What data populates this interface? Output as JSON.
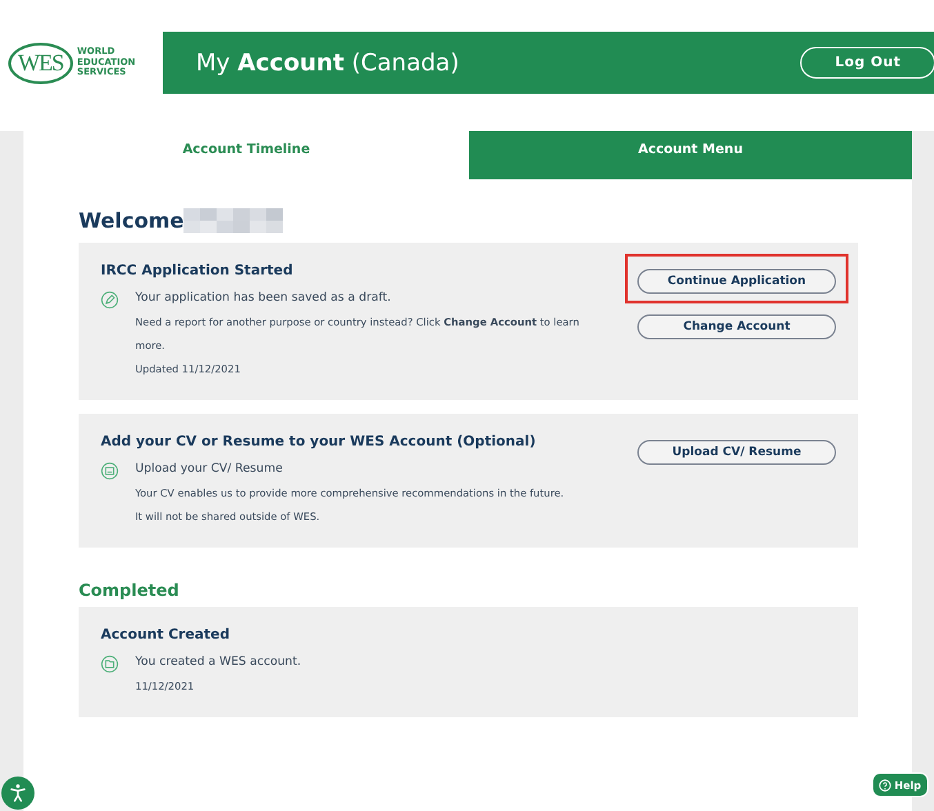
{
  "header": {
    "logo": {
      "mark": "WES",
      "words": [
        "WORLD",
        "EDUCATION",
        "SERVICES"
      ]
    },
    "title": "My **Account** (Canada)",
    "logout": "Log Out"
  },
  "tabs": [
    {
      "label": "Account Timeline",
      "selected": true
    },
    {
      "label": "Account Menu",
      "selected": false
    }
  ],
  "welcome": {
    "text": "Welcome",
    "name_hidden": true
  },
  "cards": [
    {
      "kind": "draft",
      "title": "IRCC Application Started",
      "lines": [
        "Your application has been saved as a draft.",
        "Need a report for another purpose or country instead? Click **Change Account** to learn more.",
        "Updated 11/12/2021"
      ],
      "buttons": [
        {
          "label": "Continue Application",
          "highlighted": true
        },
        {
          "label": "Change Account",
          "highlighted": false
        }
      ]
    },
    {
      "kind": "upload",
      "title": "Add your CV or Resume to your WES Account (Optional)",
      "lines": [
        "Upload your CV/ Resume",
        "Your CV enables us to provide more comprehensive recommendations in the future.",
        "It will not be shared outside of WES."
      ],
      "buttons": [
        {
          "label": "Upload CV/ Resume",
          "highlighted": false
        }
      ]
    }
  ],
  "completed": {
    "heading": "Completed",
    "cards": [
      {
        "kind": "created",
        "title": "Account Created",
        "lines": [
          "You created a WES account.",
          "11/12/2021"
        ]
      }
    ]
  },
  "help": "Help"
}
